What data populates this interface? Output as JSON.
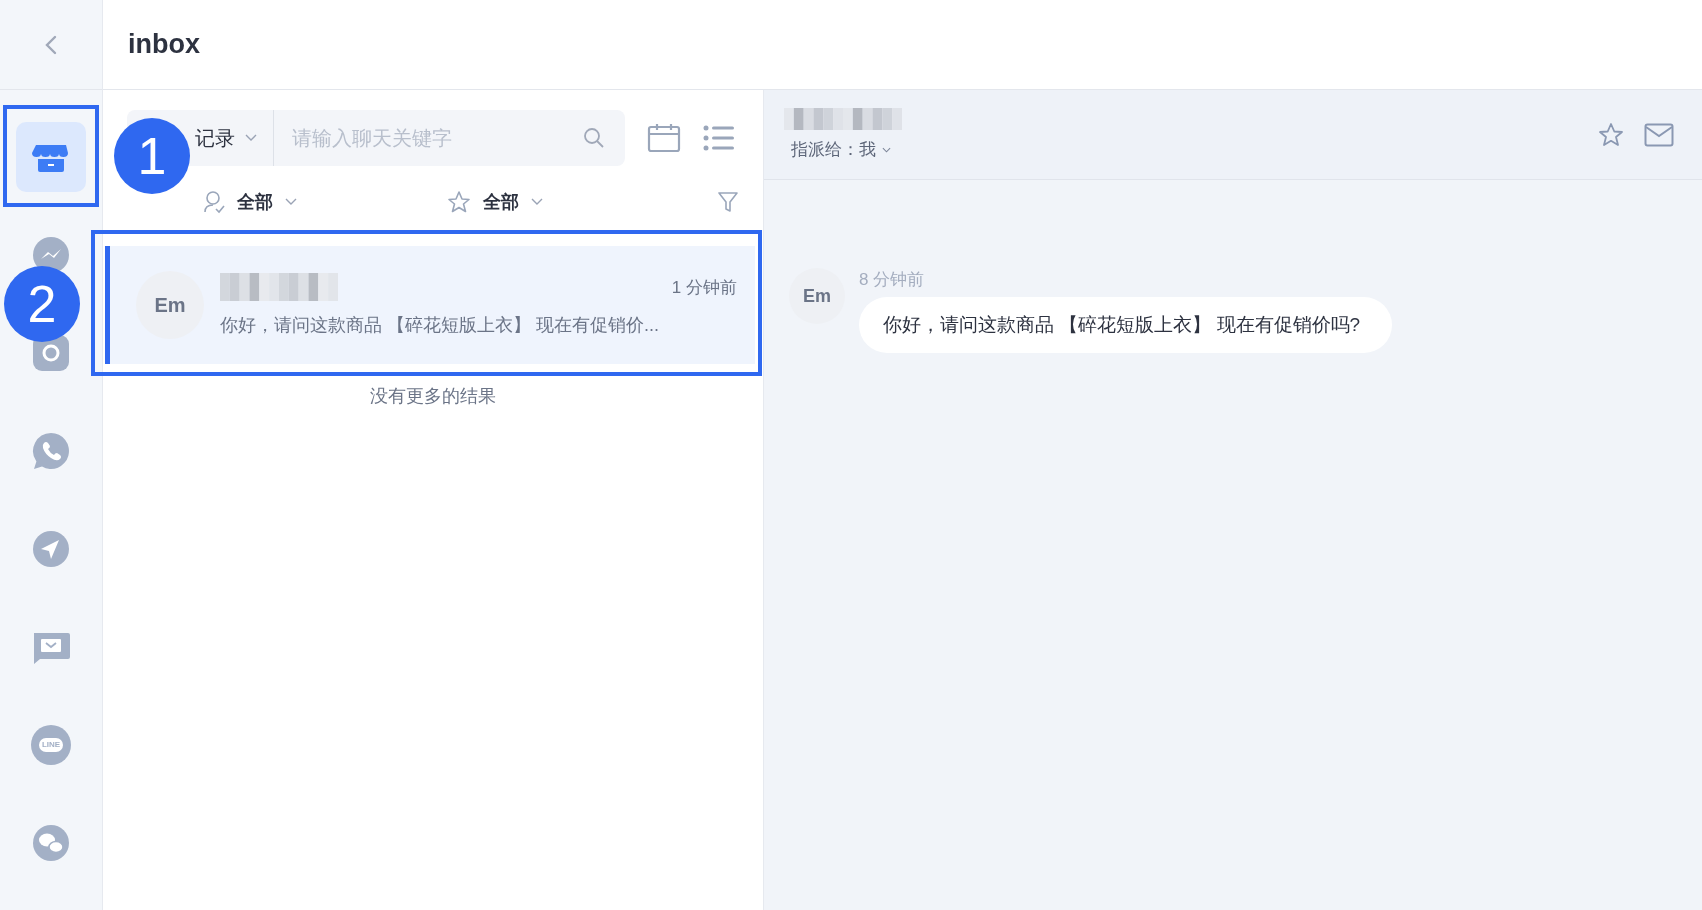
{
  "header": {
    "title": "inbox"
  },
  "channels": [
    {
      "kind": "store",
      "selected": true
    },
    {
      "kind": "messenger",
      "selected": false
    },
    {
      "kind": "instagram",
      "selected": false
    },
    {
      "kind": "whatsapp",
      "selected": false
    },
    {
      "kind": "telegram",
      "selected": false
    },
    {
      "kind": "sms",
      "selected": false
    },
    {
      "kind": "line",
      "selected": false,
      "logo_text": "LINE"
    },
    {
      "kind": "wechat",
      "selected": false
    }
  ],
  "search": {
    "scope": "记录",
    "placeholder": "请输入聊天关键字"
  },
  "filters": [
    {
      "kind": "assignee",
      "label": "全部"
    },
    {
      "kind": "star",
      "label": "全部"
    }
  ],
  "conversations": [
    {
      "avatar": "Em",
      "time": "1 分钟前",
      "preview": "你好，请问这款商品 【碎花短版上衣】 现在有促销价...",
      "selected": true
    }
  ],
  "list_end": "没有更多的结果",
  "chat": {
    "assigned_label": "指派给：",
    "assignee": "我",
    "messages": [
      {
        "avatar": "Em",
        "time": "8 分钟前",
        "text": "你好，请问这款商品 【碎花短版上衣】 现在有促销价吗?"
      }
    ]
  },
  "annotations": [
    {
      "number": "1"
    },
    {
      "number": "2"
    }
  ]
}
